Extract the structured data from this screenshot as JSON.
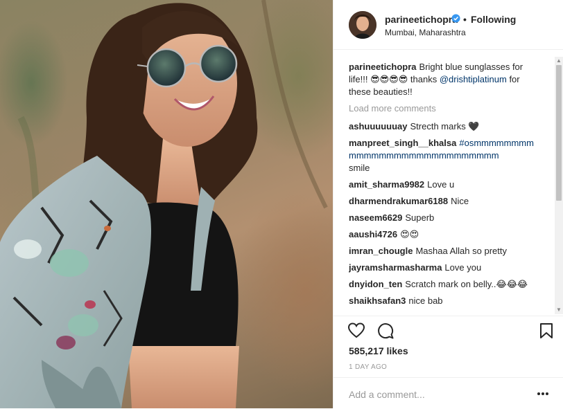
{
  "post": {
    "image": {
      "alt": "Woman wearing round blue sunglasses and a painted denim jacket"
    },
    "header": {
      "username": "parineetichopra",
      "verified_icon": "verified-badge-icon",
      "separator": "•",
      "follow_status": "Following",
      "location": "Mumbai, Maharashtra"
    },
    "caption": {
      "username": "parineetichopra",
      "text": "Bright blue sunglasses for life!!! 😎😎😎😎 thanks ",
      "mention": "@drishtiplatinum",
      "text_after": " for these beauties!!"
    },
    "load_more": "Load more comments",
    "comments": [
      {
        "username": "ashuuuuuuay",
        "text": "Strecth marks 🖤"
      },
      {
        "username": "manpreet_singh__khalsa",
        "mention": "#osmmmmmmmmmmmmmmmmmmmmmmmmmmmm",
        "text": "smile"
      },
      {
        "username": "amit_sharma9982",
        "text": "Love u"
      },
      {
        "username": "dharmendrakumar6188",
        "text": "Nice"
      },
      {
        "username": "naseem6629",
        "text": "Superb"
      },
      {
        "username": "aaushi4726",
        "text": "😍😍"
      },
      {
        "username": "imran_chougle",
        "text": "Mashaa Allah so pretty"
      },
      {
        "username": "jayramsharmasharma",
        "text": "Love you"
      },
      {
        "username": "dnyidon_ten",
        "text": "Scratch mark on belly..😂😂😂"
      },
      {
        "username": "shaikhsafan3",
        "text": "nice bab"
      }
    ],
    "actions": {
      "like_icon": "heart-icon",
      "comment_icon": "comment-bubble-icon",
      "save_icon": "bookmark-icon"
    },
    "likes": "585,217 likes",
    "timestamp": "1 DAY AGO",
    "add_comment": {
      "placeholder": "Add a comment...",
      "more_icon": "more-options-icon"
    },
    "colors": {
      "text": "#262626",
      "muted": "#999999",
      "mention": "#003569",
      "verified": "#3897f0"
    }
  }
}
